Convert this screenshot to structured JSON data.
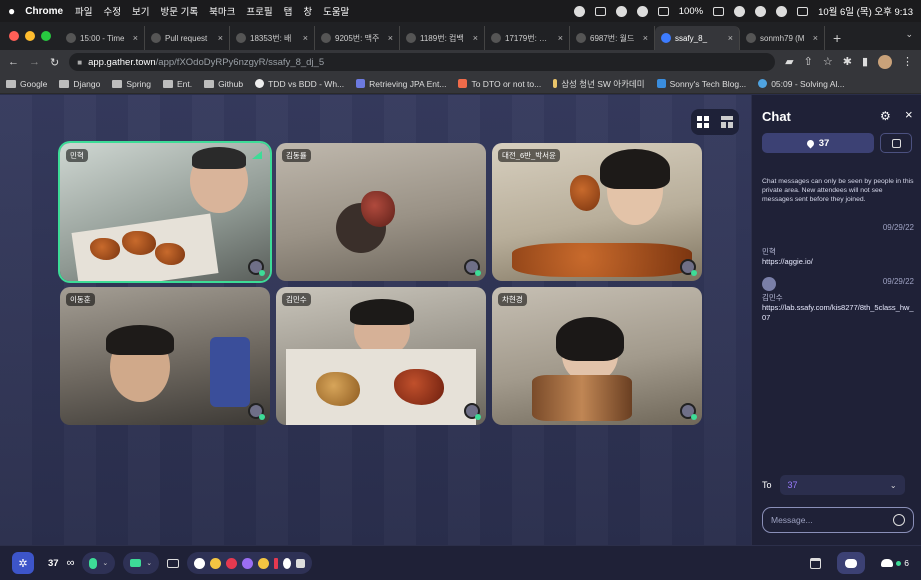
{
  "menubar": {
    "app": "Chrome",
    "items": [
      "파일",
      "수정",
      "보기",
      "방문 기록",
      "북마크",
      "프로필",
      "탭",
      "창",
      "도움말"
    ],
    "battery": "100%",
    "clock": "10월 6일 (목) 오후 9:13"
  },
  "tabs": [
    {
      "label": "15:00 - Time",
      "active": false
    },
    {
      "label": "Pull request",
      "active": false
    },
    {
      "label": "18353번: 배",
      "active": false
    },
    {
      "label": "9205번: 맥주",
      "active": false
    },
    {
      "label": "1189번: 컴백",
      "active": false
    },
    {
      "label": "17179번: 케이",
      "active": false
    },
    {
      "label": "6987번: 월드",
      "active": false
    },
    {
      "label": "ssafy_8_",
      "active": true
    },
    {
      "label": "sonmh79 (M",
      "active": false
    }
  ],
  "address": {
    "host": "app.gather.town",
    "path": "/app/fXOdoDyRPy6nzgyR/ssafy_8_dj_5"
  },
  "bookmarks": [
    {
      "label": "Google",
      "kind": "folder"
    },
    {
      "label": "Django",
      "kind": "folder"
    },
    {
      "label": "Spring",
      "kind": "folder"
    },
    {
      "label": "Ent.",
      "kind": "folder"
    },
    {
      "label": "Github",
      "kind": "folder"
    },
    {
      "label": "TDD vs BDD - Wh...",
      "kind": "site"
    },
    {
      "label": "Retrieving JPA Ent...",
      "kind": "site"
    },
    {
      "label": "To DTO or not to...",
      "kind": "site"
    },
    {
      "label": "삼성 청년 SW 아카데미",
      "kind": "site"
    },
    {
      "label": "Sonny's Tech Blog...",
      "kind": "site"
    },
    {
      "label": "05:09 - Solving Al...",
      "kind": "site"
    }
  ],
  "participants": [
    {
      "name": "민혁",
      "speaking": true
    },
    {
      "name": "김동률",
      "speaking": false
    },
    {
      "name": "대전_6반_박서윤",
      "speaking": false
    },
    {
      "name": "이동훈",
      "speaking": false
    },
    {
      "name": "김민수",
      "speaking": false
    },
    {
      "name": "차현경",
      "speaking": false
    }
  ],
  "chat": {
    "title": "Chat",
    "nearby_count": "37",
    "notice": "Chat messages can only be seen by people in this private area. New attendees will not see messages sent before they joined.",
    "messages": [
      {
        "date": "09/29/22",
        "sender": "민혁",
        "text": "https://aggie.io/"
      },
      {
        "date": "09/29/22",
        "sender": "김민수",
        "text": "https://lab.ssafy.com/kis8277/8th_5class_hw_07"
      }
    ],
    "to_label": "To",
    "to_value": "37",
    "input_placeholder": "Message..."
  },
  "toolbar": {
    "count": "37",
    "online_count": "6"
  },
  "colors": {
    "accent_green": "#3ddc97",
    "panel_bg": "#1f2137",
    "stage_bg": "#31365a"
  }
}
